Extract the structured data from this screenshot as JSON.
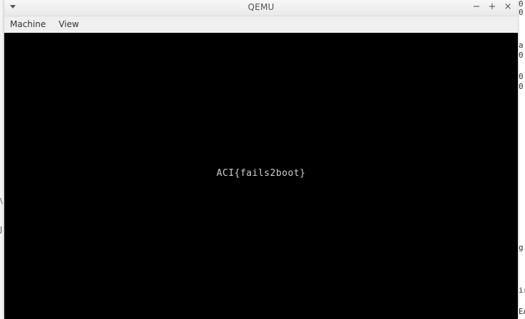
{
  "window": {
    "title": "QEMU",
    "controls": {
      "minimize": "−",
      "maximize": "+",
      "close": "×"
    }
  },
  "menu": {
    "items": [
      "Machine",
      "View"
    ]
  },
  "screen": {
    "output": "ACI{fails2boot}"
  },
  "background": {
    "right_glyphs": [
      "0",
      "0",
      "a",
      "0",
      "0",
      "0",
      "g",
      "ir",
      "EA"
    ],
    "left_glyphs": [
      "\\",
      "J"
    ]
  },
  "colors": {
    "screen_bg": "#000000",
    "screen_fg": "#cfcfcf"
  }
}
